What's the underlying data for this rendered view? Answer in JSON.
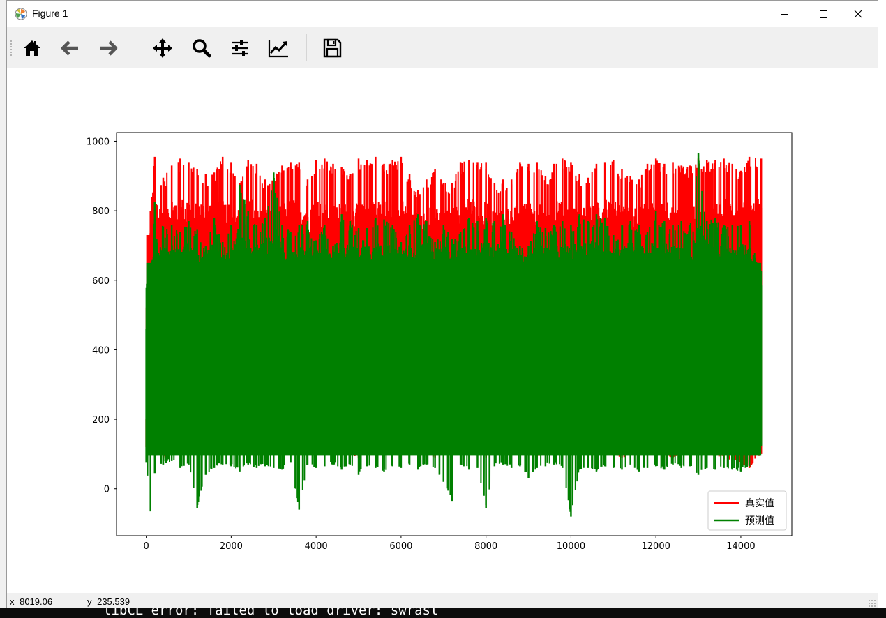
{
  "window": {
    "title": "Figure 1",
    "icon": "matplotlib-icon"
  },
  "controls": [
    "minimize-icon",
    "maximize-icon",
    "close-icon"
  ],
  "toolbar": {
    "buttons": [
      {
        "icon": "home-icon"
      },
      {
        "icon": "back-arrow-icon"
      },
      {
        "icon": "forward-arrow-icon"
      },
      {
        "icon": "pan-icon"
      },
      {
        "icon": "zoom-icon"
      },
      {
        "icon": "subplots-config-icon"
      },
      {
        "icon": "edit-curve-icon"
      },
      {
        "icon": "save-icon"
      }
    ]
  },
  "status": {
    "x": "x=8019.06",
    "y": "y=235.539"
  },
  "background": {
    "terminal_text": "libCL error: failed to load driver: swrast"
  },
  "chart_data": {
    "type": "line",
    "title": "",
    "xlabel": "",
    "ylabel": "",
    "xlim": [
      -700,
      15200
    ],
    "ylim": [
      -135,
      1025
    ],
    "xticks": [
      0,
      2000,
      4000,
      6000,
      8000,
      10000,
      12000,
      14000
    ],
    "yticks": [
      0,
      200,
      400,
      600,
      800,
      1000
    ],
    "legend_position": "lower right",
    "series": [
      {
        "name": "真实值",
        "color": "#ff0000",
        "x": [
          0,
          100,
          200,
          400,
          600,
          800,
          1000,
          1200,
          1400,
          1600,
          1800,
          2000,
          2200,
          2400,
          2600,
          2800,
          3000,
          3200,
          3400,
          3600,
          3800,
          4000,
          4200,
          4400,
          4600,
          4800,
          5000,
          5200,
          5400,
          5600,
          5800,
          6000,
          6200,
          6400,
          6600,
          6800,
          7000,
          7200,
          7400,
          7600,
          7800,
          8000,
          8200,
          8400,
          8600,
          8800,
          9000,
          9200,
          9400,
          9600,
          9800,
          10000,
          10200,
          10400,
          10600,
          10800,
          11000,
          11200,
          11400,
          11600,
          11800,
          12000,
          12200,
          12400,
          12600,
          12800,
          13000,
          13200,
          13400,
          13600,
          13800,
          14000,
          14200,
          14480
        ],
        "max": [
          200,
          800,
          955,
          895,
          930,
          950,
          940,
          920,
          905,
          910,
          955,
          940,
          880,
          945,
          935,
          890,
          900,
          930,
          940,
          940,
          890,
          945,
          950,
          935,
          925,
          905,
          950,
          945,
          955,
          935,
          945,
          955,
          905,
          860,
          890,
          920,
          880,
          880,
          940,
          945,
          940,
          940,
          880,
          890,
          890,
          940,
          935,
          940,
          900,
          935,
          950,
          940,
          905,
          895,
          935,
          940,
          945,
          920,
          900,
          890,
          935,
          950,
          935,
          940,
          930,
          930,
          950,
          945,
          945,
          950,
          935,
          915,
          955,
          950
        ],
        "min": [
          120,
          95,
          95,
          90,
          100,
          95,
          95,
          100,
          95,
          100,
          95,
          100,
          95,
          100,
          95,
          90,
          100,
          95,
          95,
          90,
          100,
          95,
          100,
          95,
          100,
          95,
          90,
          95,
          100,
          95,
          90,
          95,
          100,
          95,
          100,
          90,
          95,
          100,
          95,
          100,
          95,
          90,
          95,
          100,
          95,
          100,
          95,
          90,
          95,
          100,
          95,
          100,
          95,
          90,
          95,
          100,
          95,
          90,
          95,
          100,
          95,
          100,
          95,
          90,
          95,
          100,
          95,
          90,
          95,
          85,
          80,
          70,
          60,
          100
        ]
      },
      {
        "name": "预测值",
        "color": "#008000",
        "x": [
          0,
          100,
          200,
          400,
          600,
          800,
          1000,
          1200,
          1400,
          1600,
          1800,
          2000,
          2200,
          2400,
          2600,
          2800,
          3000,
          3200,
          3400,
          3600,
          3800,
          4000,
          4200,
          4400,
          4600,
          4800,
          5000,
          5200,
          5400,
          5600,
          5800,
          6000,
          6200,
          6400,
          6600,
          6800,
          7000,
          7200,
          7400,
          7600,
          7800,
          8000,
          8200,
          8400,
          8600,
          8800,
          9000,
          9200,
          9400,
          9600,
          9800,
          10000,
          10200,
          10400,
          10600,
          10800,
          11000,
          11200,
          11400,
          11600,
          11800,
          12000,
          12200,
          12400,
          12600,
          12800,
          13000,
          13200,
          13400,
          13600,
          13800,
          14000,
          14200,
          14480
        ],
        "max": [
          460,
          600,
          825,
          755,
          760,
          740,
          770,
          745,
          700,
          780,
          710,
          760,
          875,
          800,
          760,
          780,
          910,
          760,
          740,
          760,
          770,
          715,
          760,
          700,
          790,
          770,
          750,
          750,
          780,
          775,
          760,
          710,
          760,
          790,
          770,
          710,
          760,
          720,
          740,
          780,
          770,
          780,
          770,
          790,
          740,
          700,
          700,
          770,
          750,
          760,
          770,
          760,
          790,
          770,
          790,
          780,
          730,
          760,
          770,
          760,
          740,
          800,
          770,
          760,
          770,
          760,
          965,
          770,
          780,
          760,
          760,
          760,
          770,
          585
        ],
        "min": [
          75,
          -65,
          45,
          70,
          80,
          60,
          70,
          -55,
          40,
          60,
          70,
          65,
          50,
          70,
          60,
          65,
          60,
          55,
          75,
          -60,
          70,
          60,
          65,
          70,
          55,
          70,
          40,
          65,
          60,
          50,
          65,
          60,
          70,
          55,
          70,
          60,
          20,
          -35,
          70,
          55,
          60,
          -55,
          65,
          70,
          60,
          65,
          30,
          60,
          65,
          70,
          60,
          -80,
          55,
          60,
          50,
          65,
          60,
          55,
          70,
          50,
          60,
          65,
          55,
          70,
          60,
          65,
          40,
          60,
          55,
          60,
          55,
          50,
          65,
          125
        ]
      }
    ]
  }
}
